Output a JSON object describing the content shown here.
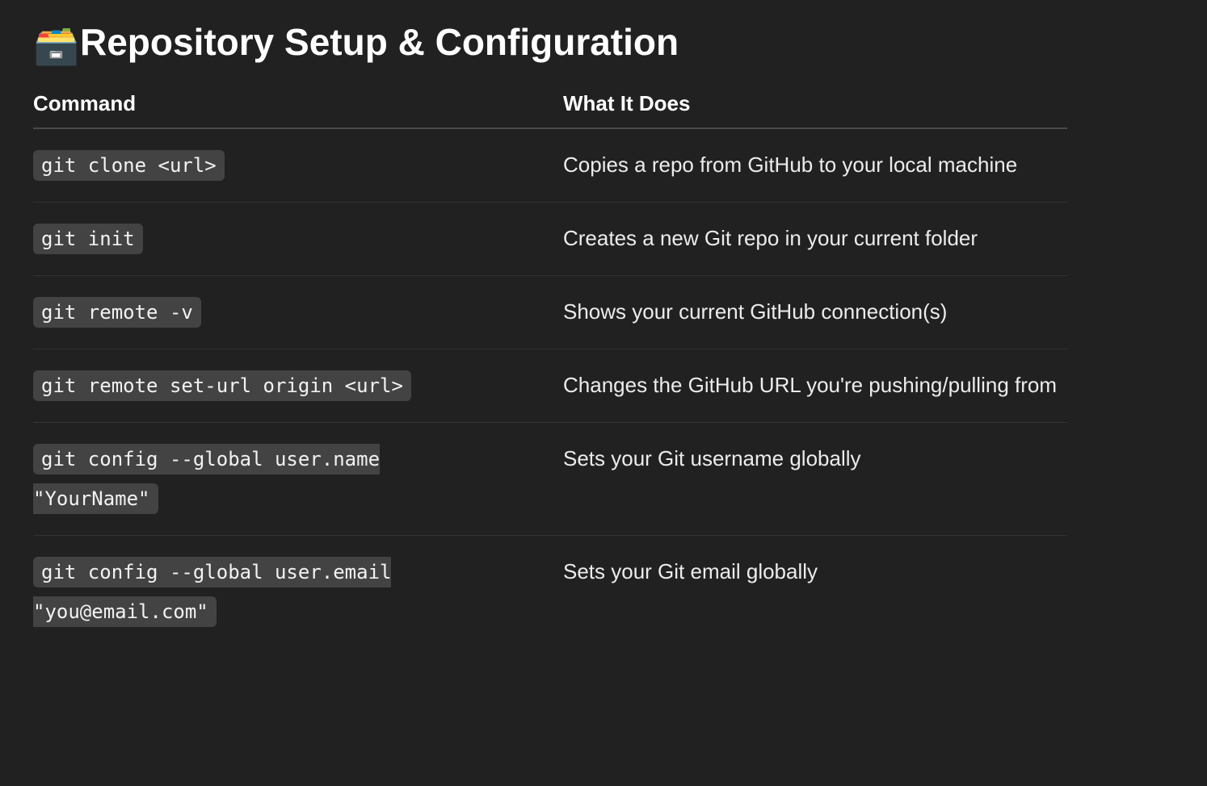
{
  "title": {
    "emoji": "🗃️",
    "text": "Repository Setup & Configuration"
  },
  "table": {
    "headers": [
      "Command",
      "What It Does"
    ],
    "rows": [
      {
        "command": "git clone <url>",
        "description": "Copies a repo from GitHub to your local machine"
      },
      {
        "command": "git init",
        "description": "Creates a new Git repo in your current folder"
      },
      {
        "command": "git remote -v",
        "description": "Shows your current GitHub connection(s)"
      },
      {
        "command": "git remote set-url origin <url>",
        "description": "Changes the GitHub URL you're pushing/pulling from"
      },
      {
        "command": "git config --global user.name \"YourName\"",
        "description": "Sets your Git username globally"
      },
      {
        "command": "git config --global user.email \"you@email.com\"",
        "description": "Sets your Git email globally"
      }
    ]
  }
}
